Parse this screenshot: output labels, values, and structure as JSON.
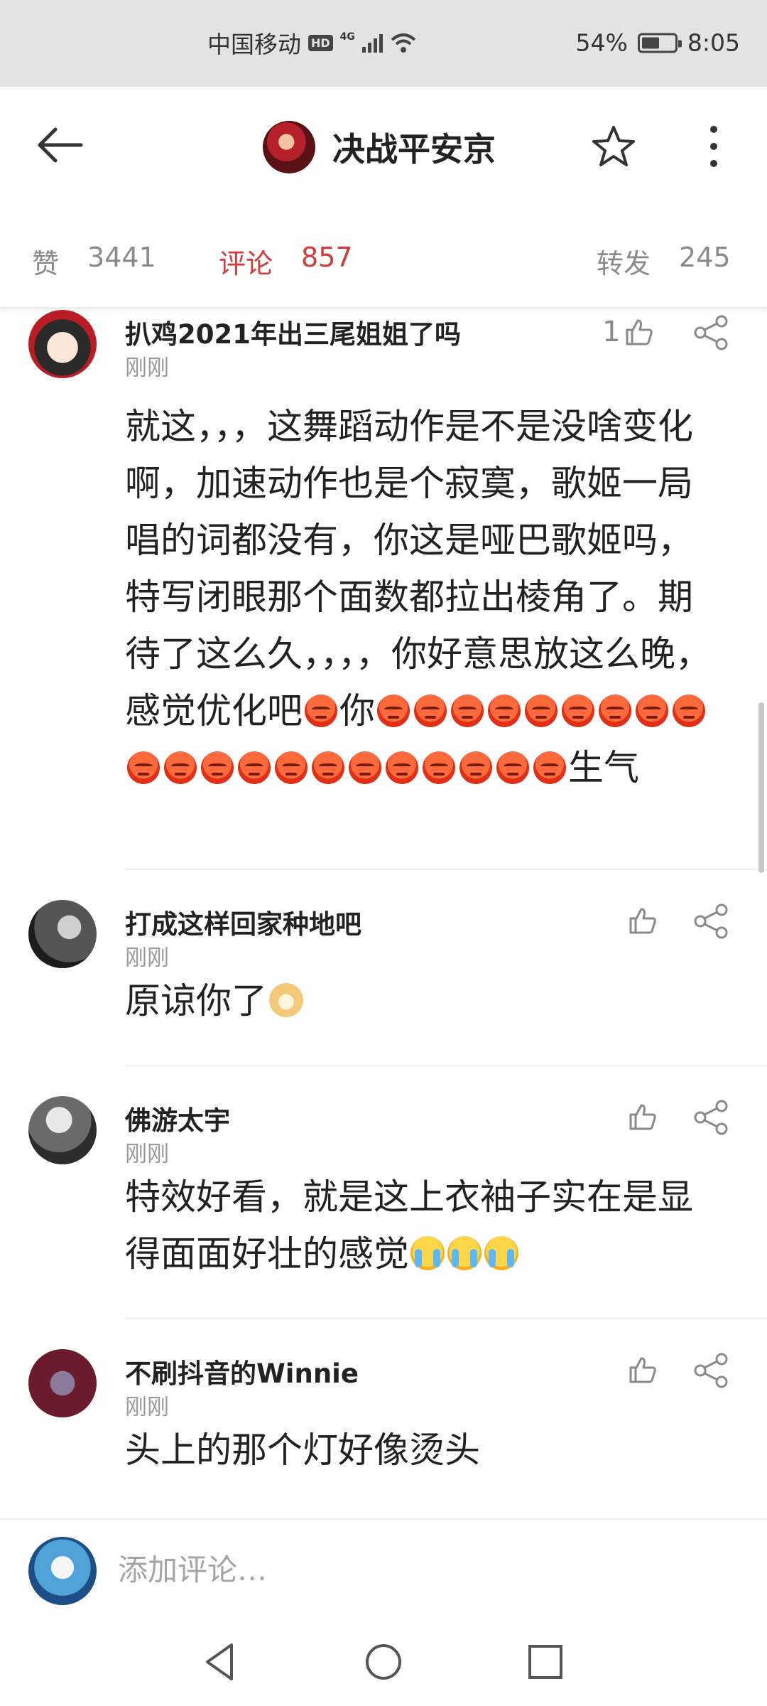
{
  "status_bar": {
    "carrier": "中国移动",
    "hd": "HD",
    "network": "4G",
    "battery_percent_label": "54%",
    "battery_level": 0.54,
    "time": "8:05"
  },
  "header": {
    "title": "决战平安京",
    "icons": {
      "back": "back-arrow-icon",
      "star": "star-icon",
      "more": "more-vertical-icon"
    }
  },
  "stats": {
    "likes_label": "赞",
    "likes_count": "3441",
    "comments_label": "评论",
    "comments_count": "857",
    "forwards_label": "转发",
    "forwards_count": "245",
    "active_color": "#d33a3a"
  },
  "comments": [
    {
      "name": "扒鸡2021年出三尾姐姐了吗",
      "time": "刚刚",
      "likes": "1",
      "text_parts": [
        "就这，，，这舞蹈动作是不是没啥变化啊，加速动作也是个寂寞，歌姬一局唱的词都没有，你这是哑巴歌姬吗，特写闭眼那个面数都拉出棱角了。期待了这么久，，，，你好意思放这么晚，感觉优化吧",
        "你",
        "生气"
      ],
      "emoji_count_1": 1,
      "emoji_count_2": 21
    },
    {
      "name": "打成这样回家种地吧",
      "time": "刚刚",
      "likes": "",
      "text": "原谅你了"
    },
    {
      "name": "佛游太宇",
      "time": "刚刚",
      "likes": "",
      "text": "特效好看，就是这上衣袖子实在是显得面面好壮的感觉"
    },
    {
      "name": "不刷抖音的Winnie",
      "time": "刚刚",
      "likes": "",
      "text": "头上的那个灯好像烫头"
    }
  ],
  "input": {
    "placeholder": "添加评论…"
  },
  "nav": {
    "icons": [
      "back-triangle-icon",
      "home-circle-icon",
      "recents-square-icon"
    ]
  }
}
